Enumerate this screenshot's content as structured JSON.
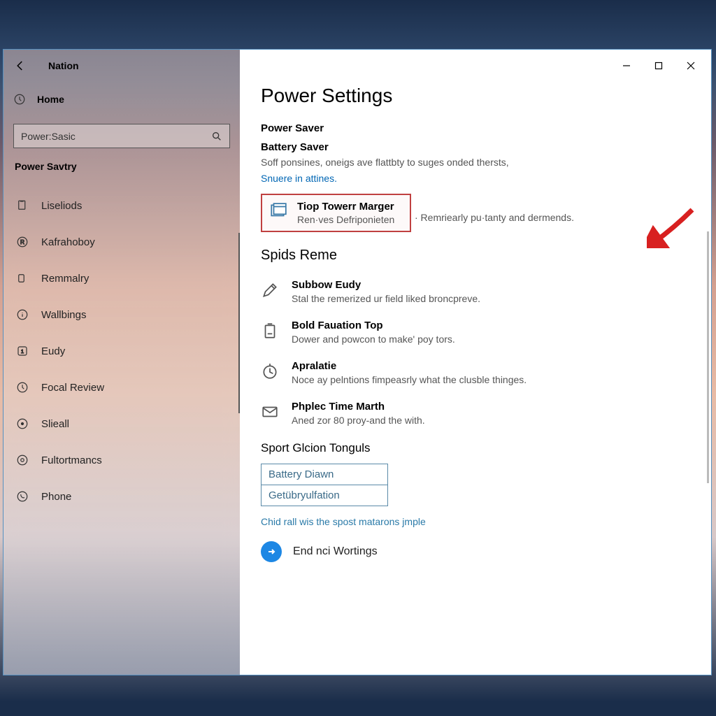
{
  "app_title": "Nation",
  "sidebar": {
    "home_label": "Home",
    "search_value": "Power:Sasic",
    "section_header": "Power Savtry",
    "items": [
      {
        "label": "Liseliods",
        "icon": "doc"
      },
      {
        "label": "Kafrahoboy",
        "icon": "circle-r"
      },
      {
        "label": "Remmalry",
        "icon": "rect"
      },
      {
        "label": "Wallbings",
        "icon": "info"
      },
      {
        "label": "Eudy",
        "icon": "num"
      },
      {
        "label": "Focal Review",
        "icon": "clock"
      },
      {
        "label": "Slieall",
        "icon": "dot"
      },
      {
        "label": "Fultortmancs",
        "icon": "gear"
      },
      {
        "label": "Phone",
        "icon": "phone"
      }
    ]
  },
  "main": {
    "page_title": "Power Settings",
    "power_saver_title": "Power Saver",
    "battery_saver_title": "Battery Saver",
    "battery_saver_desc": "Soff ponsines, oneigs ave flattbty to suges onded thersts,",
    "link_text": "Snuere in attines.",
    "highlighted": {
      "title": "Tiop Towerr Marger",
      "desc": "Ren·ves Defriponieten",
      "desc_extra": "· Remriearly pu·tanty and dermends."
    },
    "section2_title": "Spids Reme",
    "options": [
      {
        "title": "Subbow Eudy",
        "desc": "Stal the remerized ur field liked broncpreve.",
        "icon": "pencil"
      },
      {
        "title": "Bold Fauation Top",
        "desc": "Dower and powcon to make' poy tors.",
        "icon": "battery"
      },
      {
        "title": "Apralatie",
        "desc": "Noce ay pelntions fimpeasrly what the clusble thinges.",
        "icon": "clock"
      },
      {
        "title": "Phplec Time Marth",
        "desc": "Aned zor 80 proy-and the with.",
        "icon": "mail"
      }
    ],
    "section3_title": "Sport Glcion Tonguls",
    "related": [
      {
        "label": "Battery Diawn"
      },
      {
        "label": "Getübryulfation"
      }
    ],
    "help_link": "Chid rall wis the spost matarons jmple",
    "bottom_action": "End nci Wortings"
  }
}
